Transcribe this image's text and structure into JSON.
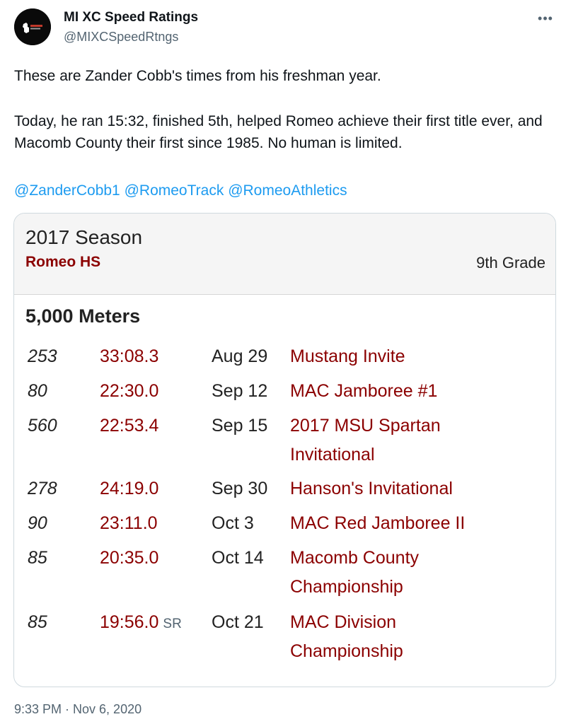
{
  "author": {
    "name": "MI XC Speed Ratings",
    "handle": "@MIXCSpeedRtngs"
  },
  "tweet": {
    "paragraph1": "These are Zander Cobb's times from his freshman year.",
    "paragraph2": "Today, he ran 15:32, finished 5th, helped Romeo achieve their first title ever, and Macomb County their first since 1985. No human is limited.",
    "mentions": [
      "@ZanderCobb1",
      "@RomeoTrack",
      "@RomeoAthletics"
    ],
    "timestamp": "9:33 PM · Nov 6, 2020"
  },
  "card": {
    "season": "2017 Season",
    "school": "Romeo HS",
    "grade": "9th Grade",
    "event": "5,000 Meters",
    "results": [
      {
        "rank": "253",
        "time": "33:08.3",
        "badge": "",
        "date": "Aug 29",
        "meet": "Mustang Invite"
      },
      {
        "rank": "80",
        "time": "22:30.0",
        "badge": "",
        "date": "Sep 12",
        "meet": "MAC Jamboree #1"
      },
      {
        "rank": "560",
        "time": "22:53.4",
        "badge": "",
        "date": "Sep 15",
        "meet": "2017 MSU Spartan Invitational"
      },
      {
        "rank": "278",
        "time": "24:19.0",
        "badge": "",
        "date": "Sep 30",
        "meet": "Hanson's Invitational"
      },
      {
        "rank": "90",
        "time": "23:11.0",
        "badge": "",
        "date": "Oct 3",
        "meet": "MAC Red Jamboree II"
      },
      {
        "rank": "85",
        "time": "20:35.0",
        "badge": "",
        "date": "Oct 14",
        "meet": "Macomb County Championship"
      },
      {
        "rank": "85",
        "time": "19:56.0",
        "badge": "SR",
        "date": "Oct 21",
        "meet": "MAC Division Championship"
      }
    ]
  },
  "colors": {
    "link": "#1d9bf0",
    "accent": "#8b0000",
    "muted": "#536471"
  },
  "icons": {
    "more": "more-icon",
    "avatar": "michigan-logo-icon"
  }
}
